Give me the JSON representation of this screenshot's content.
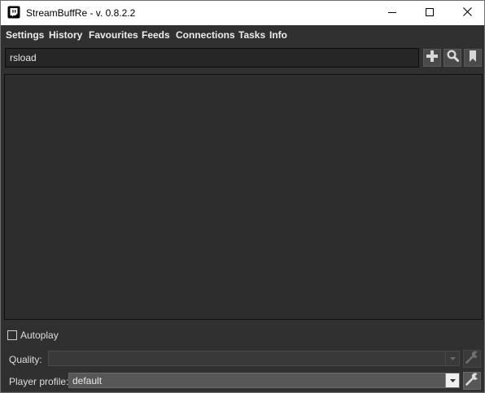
{
  "window": {
    "title": "StreamBuffRe - v. 0.8.2.2",
    "icon": "twitch-glyph-icon",
    "controls": [
      "minimize-icon",
      "maximize-icon",
      "close-icon"
    ]
  },
  "menu": {
    "items": [
      {
        "label": "Settings"
      },
      {
        "label": "History"
      },
      {
        "label": "Favourites"
      },
      {
        "label": "Feeds"
      },
      {
        "label": "Connections"
      },
      {
        "label": "Tasks"
      },
      {
        "label": "Info"
      }
    ]
  },
  "search": {
    "value": "rsload",
    "buttons": [
      "plus-icon",
      "magnifier-icon",
      "bookmark-icon"
    ]
  },
  "options": {
    "autoplay_label": "Autoplay",
    "autoplay_checked": false
  },
  "quality": {
    "label": "Quality:",
    "value": "",
    "enabled": false
  },
  "player_profile": {
    "label": "Player profile:",
    "value": "default",
    "enabled": true
  },
  "colors": {
    "background": "#303030",
    "panel": "#2d2d2d",
    "text": "#ececec",
    "titlebar": "#ffffff"
  }
}
